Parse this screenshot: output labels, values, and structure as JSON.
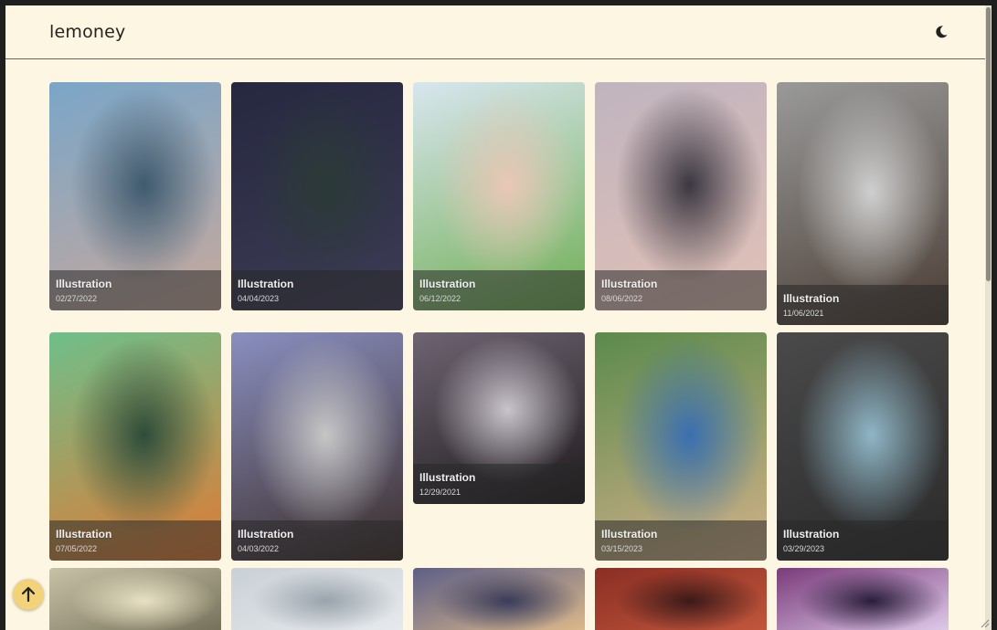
{
  "header": {
    "brand": "lemoney",
    "theme_icon": "moon-icon"
  },
  "gallery": {
    "items": [
      {
        "category": "Illustration",
        "date": "02/27/2022",
        "colors": [
          "#7aa6c8",
          "#c7a89c",
          "#3f5a6e"
        ]
      },
      {
        "category": "Illustration",
        "date": "04/04/2023",
        "colors": [
          "#262840",
          "#3d3c55",
          "#2b3a36"
        ]
      },
      {
        "category": "Illustration",
        "date": "06/12/2022",
        "colors": [
          "#d8e6ef",
          "#6fae53",
          "#e9c7b6"
        ]
      },
      {
        "category": "Illustration",
        "date": "08/06/2022",
        "colors": [
          "#c0b4bf",
          "#e2c1b6",
          "#3b3740"
        ]
      },
      {
        "category": "Illustration",
        "date": "11/06/2021",
        "colors": [
          "#9a9a9a",
          "#4a3d34",
          "#cfcfcf"
        ]
      },
      {
        "category": "Illustration",
        "date": "07/05/2022",
        "colors": [
          "#6fbf8a",
          "#e07a34",
          "#2e4d3a"
        ]
      },
      {
        "category": "Illustration",
        "date": "04/03/2022",
        "colors": [
          "#8a8fc0",
          "#3a2c28",
          "#c6c6c6"
        ]
      },
      {
        "category": "Illustration",
        "date": "12/29/2021",
        "colors": [
          "#6e6472",
          "#1e1a1c",
          "#c9c3cc"
        ]
      },
      {
        "category": "Illustration",
        "date": "03/15/2023",
        "colors": [
          "#5b8a4c",
          "#d3b18a",
          "#3a6fb0"
        ]
      },
      {
        "category": "Illustration",
        "date": "03/29/2023",
        "colors": [
          "#4a4a4a",
          "#2a2a2a",
          "#8fb6c6"
        ]
      },
      {
        "category": "",
        "date": "",
        "colors": [
          "#c7c2a6",
          "#6f6a55",
          "#e8e1c3"
        ]
      },
      {
        "category": "",
        "date": "",
        "colors": [
          "#c9d0d6",
          "#e9ecef",
          "#9aa3ab"
        ]
      },
      {
        "category": "",
        "date": "",
        "colors": [
          "#5d5f86",
          "#e6c08a",
          "#3a3c5a"
        ]
      },
      {
        "category": "",
        "date": "",
        "colors": [
          "#8a2e24",
          "#c65a3e",
          "#3b1a18"
        ]
      },
      {
        "category": "",
        "date": "",
        "colors": [
          "#7a3b7a",
          "#e6d6f2",
          "#2a1e3a"
        ]
      }
    ]
  },
  "controls": {
    "scroll_top_icon": "arrow-up-icon"
  }
}
